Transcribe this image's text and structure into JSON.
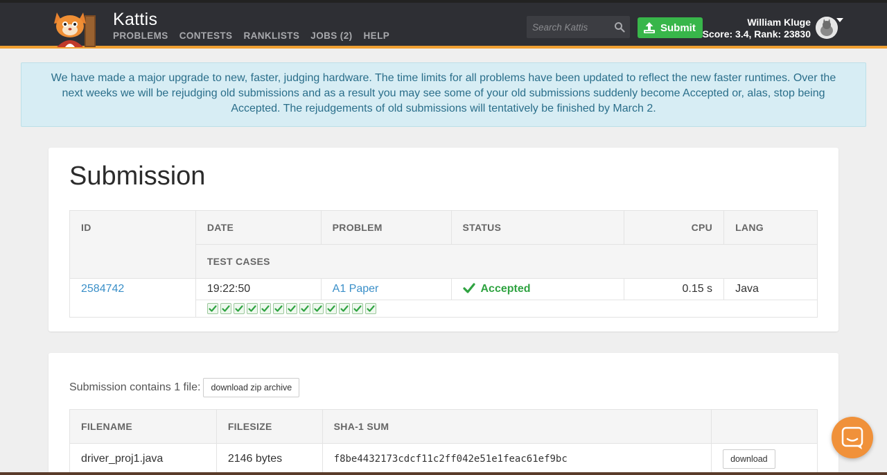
{
  "header": {
    "brand": "Kattis",
    "nav": [
      "PROBLEMS",
      "CONTESTS",
      "RANKLISTS",
      "JOBS (2)",
      "HELP"
    ],
    "search_placeholder": "Search Kattis",
    "submit_label": "Submit",
    "user_name": "William Kluge",
    "user_score": "Score: 3.4, Rank: 23830",
    "accent_color": "#f0a032"
  },
  "alert": {
    "text": "We have made a major upgrade to new, faster, judging hardware. The time limits for all problems have been updated to reflect the new faster runtimes. Over the next weeks we will be rejudging old submissions and as a result you may see some of your old submissions suddenly become Accepted or, alas, stop being Accepted. The rejudgements of old submissions will tentatively be finished by March 2."
  },
  "submission": {
    "title": "Submission",
    "columns": [
      "ID",
      "DATE",
      "PROBLEM",
      "STATUS",
      "CPU",
      "LANG"
    ],
    "test_cases_header": "TEST CASES",
    "row": {
      "id": "2584742",
      "date": "19:22:50",
      "problem": "A1 Paper",
      "status": "Accepted",
      "cpu": "0.15 s",
      "lang": "Java"
    },
    "test_cases_passed": 13
  },
  "files": {
    "summary": "Submission contains 1 file:",
    "zip_button": "download zip archive",
    "columns": [
      "FILENAME",
      "FILESIZE",
      "SHA-1 SUM",
      ""
    ],
    "rows": [
      {
        "filename": "driver_proj1.java",
        "filesize": "2146 bytes",
        "sha1": "f8be4432173cdcf11c2ff042e51e1feac61ef9bc",
        "download_label": "download"
      }
    ]
  }
}
